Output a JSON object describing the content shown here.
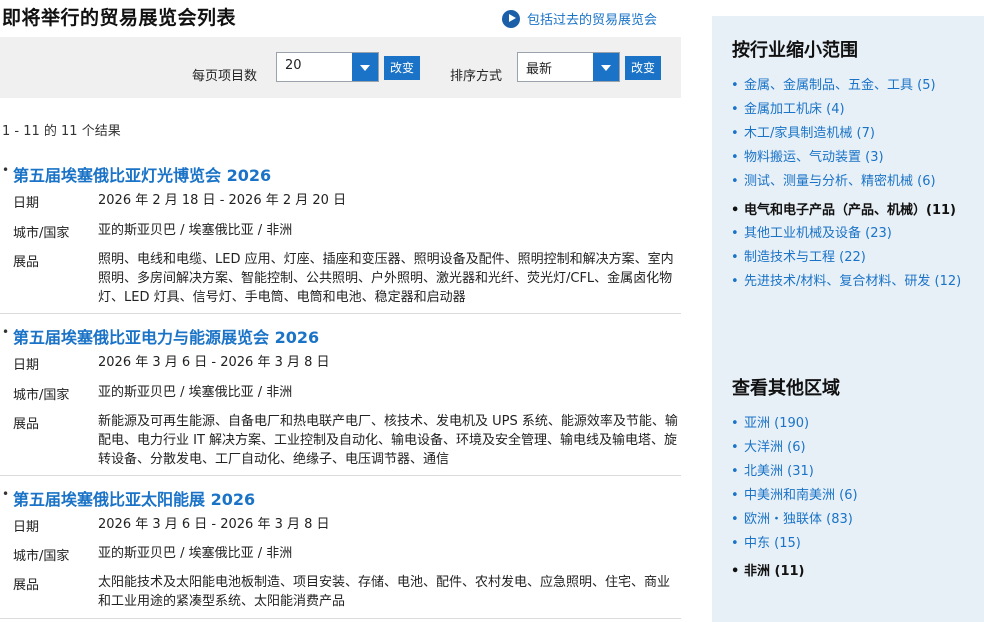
{
  "header": {
    "title": "即将举行的贸易展览会列表",
    "past_link": "包括过去的贸易展览会"
  },
  "controls": {
    "per_page_label": "每页项目数",
    "per_page_value": "20",
    "change_label": "改变",
    "sort_label": "排序方式",
    "sort_value": "最新"
  },
  "results_count": "1 - 11 的 11 个结果",
  "event_labels": {
    "date": "日期",
    "city": "城市/国家",
    "exhibits": "展品"
  },
  "events": [
    {
      "title": "第五届埃塞俄比亚灯光博览会 2026",
      "date": "2026 年 2 月 18 日 - 2026 年 2 月 20 日",
      "city": "亚的斯亚贝巴 / 埃塞俄比亚 / 非洲",
      "exhibits": "照明、电线和电缆、LED 应用、灯座、插座和变压器、照明设备及配件、照明控制和解决方案、室内照明、多房间解决方案、智能控制、公共照明、户外照明、激光器和光纤、荧光灯/CFL、金属卤化物灯、LED 灯具、信号灯、手电筒、电筒和电池、稳定器和启动器"
    },
    {
      "title": "第五届埃塞俄比亚电力与能源展览会 2026",
      "date": "2026 年 3 月 6 日 - 2026 年 3 月 8 日",
      "city": "亚的斯亚贝巴 / 埃塞俄比亚 / 非洲",
      "exhibits": "新能源及可再生能源、自备电厂和热电联产电厂、核技术、发电机及 UPS 系统、能源效率及节能、输配电、电力行业 IT 解决方案、工业控制及自动化、输电设备、环境及安全管理、输电线及输电塔、旋转设备、分散发电、工厂自动化、绝缘子、电压调节器、通信"
    },
    {
      "title": "第五届埃塞俄比亚太阳能展 2026",
      "date": "2026 年 3 月 6 日 - 2026 年 3 月 8 日",
      "city": "亚的斯亚贝巴 / 埃塞俄比亚 / 非洲",
      "exhibits": "太阳能技术及太阳能电池板制造、项目安装、存储、电池、配件、农村发电、应急照明、住宅、商业和工业用途的紧凑型系统、太阳能消费产品"
    }
  ],
  "sidebar": {
    "industry_heading": "按行业缩小范围",
    "industries": [
      "金属、金属制品、五金、工具 (5)",
      "金属加工机床 (4)",
      "木工/家具制造机械 (7)",
      "物料搬运、气动装置 (3)",
      "测试、测量与分析、精密机械 (6)",
      "电气和电子产品（产品、机械）(11)",
      "其他工业机械及设备 (23)",
      "制造技术与工程 (22)",
      "先进技术/材料、复合材料、研发 (12)"
    ],
    "region_heading": "查看其他区域",
    "regions": [
      "亚洲 (190)",
      "大洋洲 (6)",
      "北美洲 (31)",
      "中美洲和南美洲 (6)",
      "欧洲・独联体 (83)",
      "中东 (15)",
      "非洲 (11)"
    ]
  }
}
